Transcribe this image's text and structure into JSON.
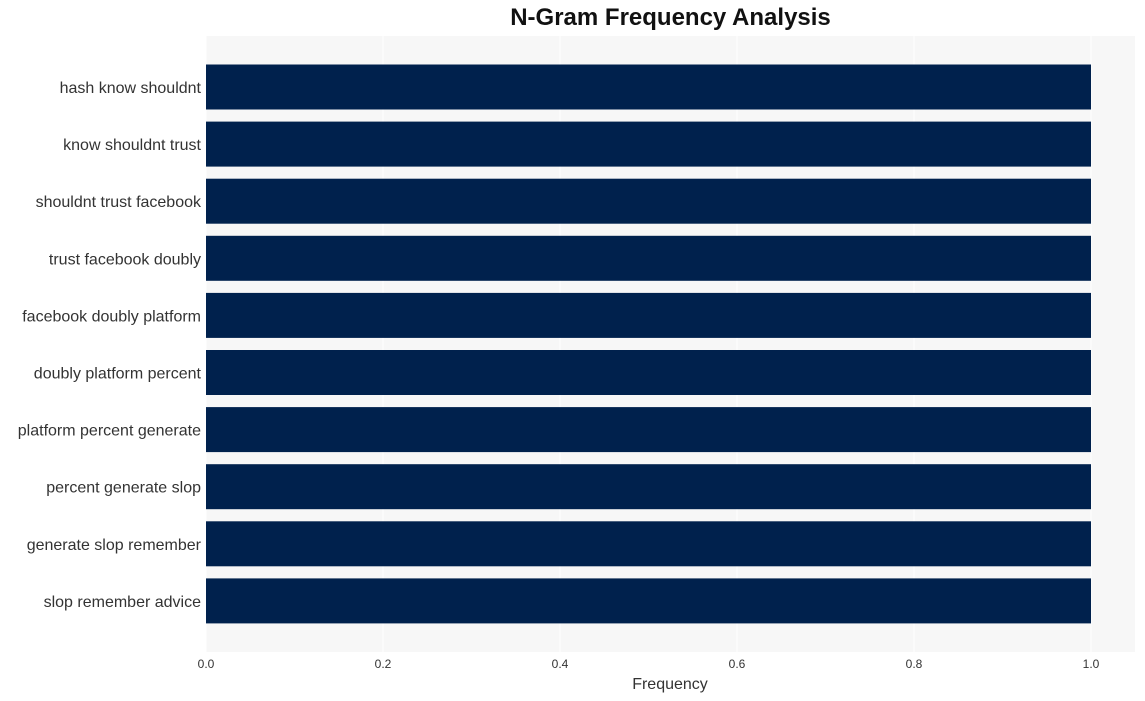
{
  "chart_data": {
    "type": "bar",
    "orientation": "horizontal",
    "title": "N-Gram Frequency Analysis",
    "xlabel": "Frequency",
    "ylabel": "",
    "categories": [
      "hash know shouldnt",
      "know shouldnt trust",
      "shouldnt trust facebook",
      "trust facebook doubly",
      "facebook doubly platform",
      "doubly platform percent",
      "platform percent generate",
      "percent generate slop",
      "generate slop remember",
      "slop remember advice"
    ],
    "values": [
      1,
      1,
      1,
      1,
      1,
      1,
      1,
      1,
      1,
      1
    ],
    "xlim": [
      0,
      1.05
    ],
    "xticks": [
      "0.0",
      "0.2",
      "0.4",
      "0.6",
      "0.8",
      "1.0"
    ],
    "grid": true,
    "legend": "none",
    "colors": {
      "bar": "#00214d",
      "plot_background": "#f7f7f7",
      "grid": "#ffffff"
    }
  }
}
